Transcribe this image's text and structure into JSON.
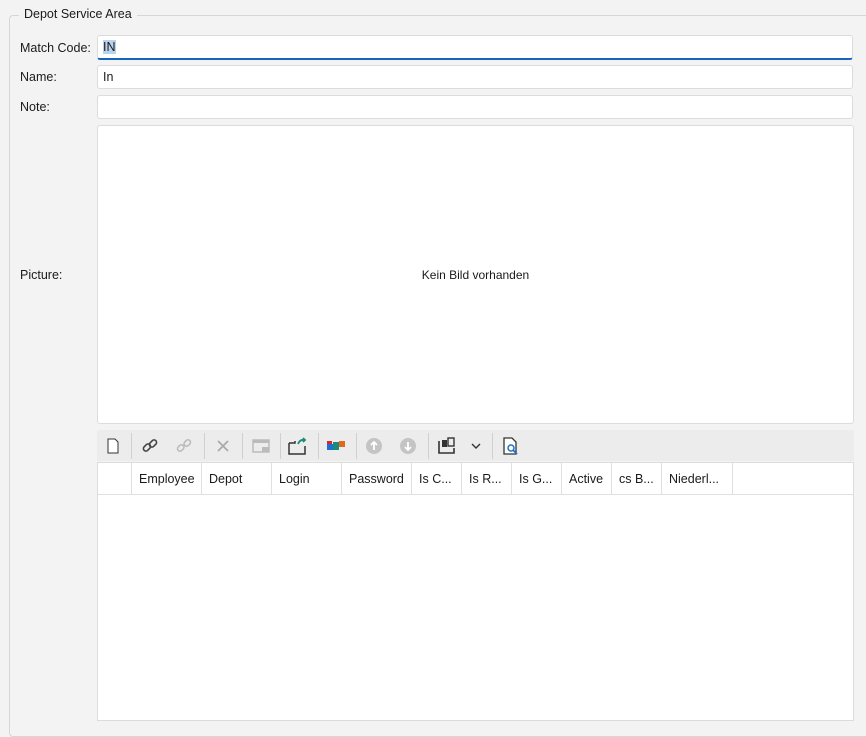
{
  "group_title": "Depot Service Area",
  "fields": {
    "match_code": {
      "label": "Match Code:",
      "value": "IN"
    },
    "name": {
      "label": "Name:",
      "value": "In"
    },
    "note": {
      "label": "Note:",
      "value": ""
    },
    "picture": {
      "label": "Picture:",
      "placeholder": "Kein Bild vorhanden"
    }
  },
  "toolbar": [
    "new-icon",
    "link-icon",
    "unlink-icon",
    "delete-icon",
    "window-icon",
    "export-icon",
    "color-blocks-icon",
    "move-up-icon",
    "move-down-icon",
    "layout-icon",
    "chevron-down-icon",
    "preview-icon"
  ],
  "grid": {
    "columns": [
      "Employee",
      "Depot",
      "Login",
      "Password",
      "Is C...",
      "Is R...",
      "Is G...",
      "Active",
      "cs B...",
      "Niederl..."
    ],
    "rows": []
  }
}
